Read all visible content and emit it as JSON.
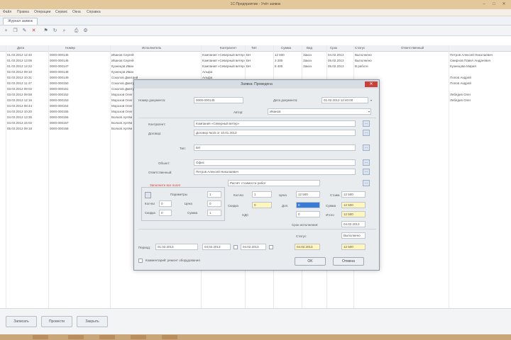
{
  "window": {
    "title": "1С:Предприятие - Учёт заявок",
    "minimize": "–",
    "maximize": "□",
    "close": "✕"
  },
  "menu": {
    "items": [
      "Файл",
      "Правка",
      "Операции",
      "Сервис",
      "Окна",
      "Справка"
    ]
  },
  "tab": {
    "label": "Журнал заявок"
  },
  "toolbar": {
    "icons": [
      "add-icon",
      "copy-icon",
      "edit-icon",
      "delete-icon",
      "filter-icon",
      "refresh-icon",
      "find-icon",
      "print-icon",
      "settings-icon"
    ],
    "glyphs": [
      "+",
      "❐",
      "✎",
      "✕",
      "⚑",
      "↻",
      "⌕",
      "⎙",
      "⚙"
    ]
  },
  "table": {
    "columns": [
      "Дата",
      "Номер",
      "Исполнитель",
      "Контрагент",
      "Тип",
      "Сумма",
      "Вид",
      "Срок",
      "Статус",
      "Ответственный"
    ],
    "rows": [
      [
        "01.02.2013 12:40",
        "0000-000145",
        "Иванов Сергей",
        "Компания «Северный ветер»",
        "БН",
        "12 500",
        "Заказ",
        "04.02.2013",
        "Выполнено",
        "Петров Алексей Николаевич"
      ],
      [
        "01.02.2013 13:05",
        "0000-000146",
        "Иванов Сергей",
        "Компания «Северный ветер»",
        "БН",
        "3 200",
        "Заказ",
        "05.02.2013",
        "Выполнено",
        "Смирнов Павел Андреевич"
      ],
      [
        "01.02.2013 14:22",
        "0000-000147",
        "Кузнецов Иван",
        "Компания «Северный ветер»",
        "БН",
        "8 400",
        "Заказ",
        "05.02.2013",
        "В работе",
        "Кузнецова Мария"
      ],
      [
        "02.02.2013 09:10",
        "0000-000148",
        "Кузнецов Иван",
        "Альфа",
        "",
        "",
        "",
        "",
        "",
        ""
      ],
      [
        "02.02.2013 10:31",
        "0000-000149",
        "Соколов Дмитрий",
        "Альфа",
        "",
        "",
        "",
        "",
        "",
        "Попов Андрей"
      ],
      [
        "02.02.2013 11:47",
        "0000-000150",
        "Соколов Дмитрий",
        "Альфа",
        "",
        "",
        "",
        "",
        "",
        "Попов Андрей"
      ],
      [
        "03.02.2013 09:02",
        "0000-000151",
        "Соколов Дмитрий",
        "Бета",
        "",
        "",
        "",
        "",
        "",
        ""
      ],
      [
        "03.02.2013 09:58",
        "0000-000152",
        "Морозов Олег",
        "Бета",
        "",
        "",
        "",
        "",
        "",
        "Лебедев Олег"
      ],
      [
        "03.02.2013 12:16",
        "0000-000153",
        "Морозов Олег",
        "Гамма",
        "",
        "",
        "",
        "",
        "",
        "Лебедев Олег"
      ],
      [
        "04.02.2013 08:44",
        "0000-000154",
        "Морозов Олег",
        "Гамма",
        "",
        "",
        "",
        "",
        "",
        ""
      ],
      [
        "04.02.2013 10:20",
        "0000-000155",
        "Морозов Олег",
        "Гамма",
        "",
        "",
        "",
        "",
        "",
        ""
      ],
      [
        "04.02.2013 13:35",
        "0000-000156",
        "Волков Артём",
        "Дельта",
        "",
        "",
        "",
        "",
        "",
        ""
      ],
      [
        "04.02.2013 15:02",
        "0000-000157",
        "Волков Артём",
        "Дельта",
        "",
        "",
        "",
        "",
        "",
        ""
      ],
      [
        "05.02.2013 09:18",
        "0000-000158",
        "Волков Артём",
        "Дельта",
        "",
        "",
        "",
        "",
        "",
        ""
      ]
    ]
  },
  "bottom": {
    "buttons": [
      "Записать",
      "Провести",
      "Закрыть"
    ]
  },
  "dialog": {
    "title": "Заявка: Проведена",
    "close": "✕",
    "number_label": "Номер документа:",
    "number_value": "0000-000145",
    "date_label": "Дата документа:",
    "date_value": "01.02.2013 12:40:00",
    "author_label": "Автор:",
    "author_value": "Иванов",
    "client_label": "Контрагент:",
    "client_value": "Компания «Северный ветер»",
    "contract_label": "Договор:",
    "contract_value": "Договор №15 от 10.01.2013",
    "type_label": "Тип:",
    "type_value": "БН",
    "object_label": "Объект:",
    "object_value": "Офис",
    "manager_label": "Ответственный:",
    "manager_value": "Петров Алексей Николаевич",
    "warning": "Заполните все поля!",
    "group": {
      "title_label": "Параметры",
      "r1": "Кол-во",
      "r2": "Цена",
      "r3": "Скидка",
      "r4": "Сумма",
      "v1": "1",
      "v2": "0",
      "v3": "0",
      "v4": "0"
    },
    "calc_title": "Расчёт стоимости работ",
    "calc": {
      "qty_label": "Кол-во",
      "qty": "1",
      "price_label": "Цена",
      "price": "12 500",
      "cost_label": "Стоим.",
      "cost": "12 500",
      "disc_label": "Скидка",
      "disc": "0",
      "extra_label": "Доп.",
      "extra": "0",
      "sum_label": "Сумма",
      "sum": "12 500",
      "total_label": "Итого",
      "total": "12 500",
      "vat_label": "НДС",
      "vat": "0"
    },
    "period_label": "Период:",
    "period_from": "01.02.2013",
    "period_to": "04.02.2013",
    "due_label": "Срок исполнения:",
    "due": "04.02.2013",
    "status_label": "Статус:",
    "status_value": "Выполнено",
    "comment_label": "Комментарий: ремонт оборудования",
    "ok_label": "OK",
    "cancel_label": "Отмена"
  },
  "colors": {
    "accent": "#3a7bd5",
    "warning": "#e03c32",
    "highlight": "#fff5bf",
    "desktop": "#d4b48a"
  }
}
